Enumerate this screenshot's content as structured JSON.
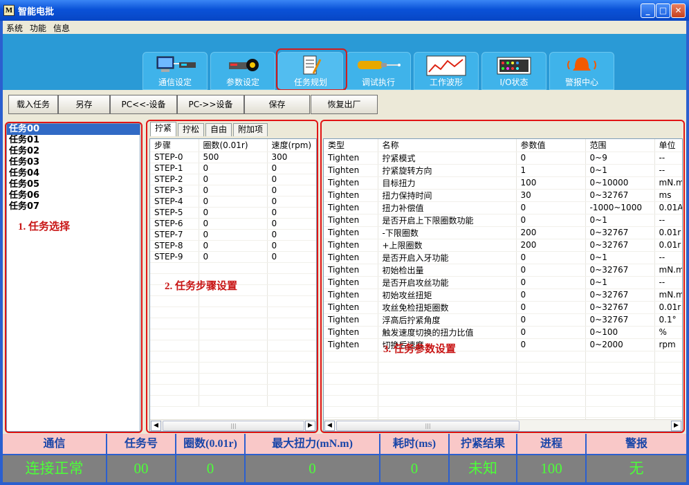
{
  "window": {
    "title": "智能电批",
    "app_icon": "M"
  },
  "menu": [
    "系统",
    "功能",
    "信息"
  ],
  "tooltabs": [
    {
      "label": "通信设定",
      "icon": "computer-network-icon"
    },
    {
      "label": "参数设定",
      "icon": "settings-meter-icon"
    },
    {
      "label": "任务规划",
      "icon": "document-pen-icon",
      "active": true
    },
    {
      "label": "调试执行",
      "icon": "screwdriver-icon"
    },
    {
      "label": "工作波形",
      "icon": "waveform-chart-icon"
    },
    {
      "label": "I/O状态",
      "icon": "io-panel-icon"
    },
    {
      "label": "警报中心",
      "icon": "alarm-bell-icon"
    }
  ],
  "toolbar": {
    "load": "载入任务",
    "saveas": "另存",
    "pc_from_device": "PC<<-设备",
    "pc_to_device": "PC->>设备",
    "save": "保存",
    "restore": "恢复出厂"
  },
  "tasks": [
    "任务00",
    "任务01",
    "任务02",
    "任务03",
    "任务04",
    "任务05",
    "任务06",
    "任务07"
  ],
  "notes": {
    "task_select": "1. 任务选择",
    "step_setting": "2. 任务步骤设置",
    "param_setting": "3. 任务参数设置"
  },
  "step_tabs": [
    "拧紧",
    "拧松",
    "自由",
    "附加项"
  ],
  "steps": {
    "headers": [
      "步骤",
      "圈数(0.01r)",
      "速度(rpm)"
    ],
    "rows": [
      [
        "STEP-0",
        "500",
        "300"
      ],
      [
        "STEP-1",
        "0",
        "0"
      ],
      [
        "STEP-2",
        "0",
        "0"
      ],
      [
        "STEP-3",
        "0",
        "0"
      ],
      [
        "STEP-4",
        "0",
        "0"
      ],
      [
        "STEP-5",
        "0",
        "0"
      ],
      [
        "STEP-6",
        "0",
        "0"
      ],
      [
        "STEP-7",
        "0",
        "0"
      ],
      [
        "STEP-8",
        "0",
        "0"
      ],
      [
        "STEP-9",
        "0",
        "0"
      ]
    ]
  },
  "params": {
    "headers": [
      "类型",
      "名称",
      "参数值",
      "范围",
      "单位"
    ],
    "rows": [
      [
        "Tighten",
        "拧紧模式",
        "0",
        "0~9",
        "--"
      ],
      [
        "Tighten",
        "拧紧旋转方向",
        "1",
        "0~1",
        "--"
      ],
      [
        "Tighten",
        "目标扭力",
        "100",
        "0~10000",
        "mN.m"
      ],
      [
        "Tighten",
        "扭力保持时间",
        "30",
        "0~32767",
        "ms"
      ],
      [
        "Tighten",
        "扭力补偿值",
        "0",
        "-1000~1000",
        "0.01A"
      ],
      [
        "Tighten",
        "是否开启上下限圈数功能",
        "0",
        "0~1",
        "--"
      ],
      [
        "Tighten",
        "-下限圈数",
        "200",
        "0~32767",
        "0.01r"
      ],
      [
        "Tighten",
        "+上限圈数",
        "200",
        "0~32767",
        "0.01r"
      ],
      [
        "Tighten",
        "是否开启入牙功能",
        "0",
        "0~1",
        "--"
      ],
      [
        "Tighten",
        "初始检出量",
        "0",
        "0~32767",
        "mN.m"
      ],
      [
        "Tighten",
        "是否开启攻丝功能",
        "0",
        "0~1",
        "--"
      ],
      [
        "Tighten",
        "初始攻丝扭矩",
        "0",
        "0~32767",
        "mN.m"
      ],
      [
        "Tighten",
        "攻丝免检扭矩圈数",
        "0",
        "0~32767",
        "0.01r"
      ],
      [
        "Tighten",
        "浮高后拧紧角度",
        "0",
        "0~32767",
        "0.1°"
      ],
      [
        "Tighten",
        "触发速度切换的扭力比值",
        "0",
        "0~100",
        "%"
      ],
      [
        "Tighten",
        "切换后速度",
        "0",
        "0~2000",
        "rpm"
      ]
    ]
  },
  "status": {
    "headers": [
      "通信",
      "任务号",
      "圈数(0.01r)",
      "最大扭力(mN.m)",
      "耗时(ms)",
      "拧紧结果",
      "进程",
      "警报"
    ],
    "values": [
      "连接正常",
      "00",
      "0",
      "0",
      "0",
      "未知",
      "100",
      "无"
    ]
  },
  "colors": {
    "highlight": "#e11414",
    "status_value": "#4cff38",
    "status_header_bg": "#f9c8c8",
    "selection": "#316ac5"
  }
}
